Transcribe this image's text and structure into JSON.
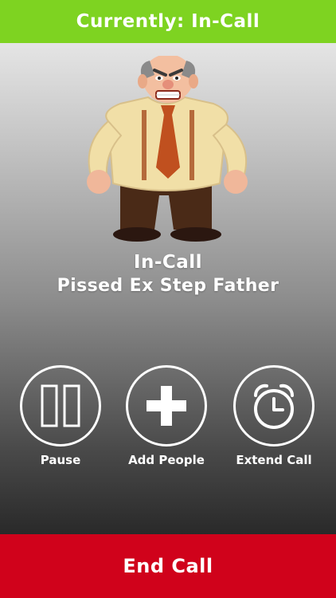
{
  "status": {
    "text": "Currently: In-Call",
    "color": "#7ed321"
  },
  "avatar": {
    "icon": "angry-man-illustration"
  },
  "call": {
    "state": "In-Call",
    "contact": "Pissed Ex Step Father"
  },
  "controls": [
    {
      "label": "Pause",
      "icon": "pause-icon"
    },
    {
      "label": "Add People",
      "icon": "plus-icon"
    },
    {
      "label": "Extend Call",
      "icon": "alarm-clock-icon"
    }
  ],
  "end_call": {
    "label": "End Call",
    "color": "#d0021b"
  }
}
